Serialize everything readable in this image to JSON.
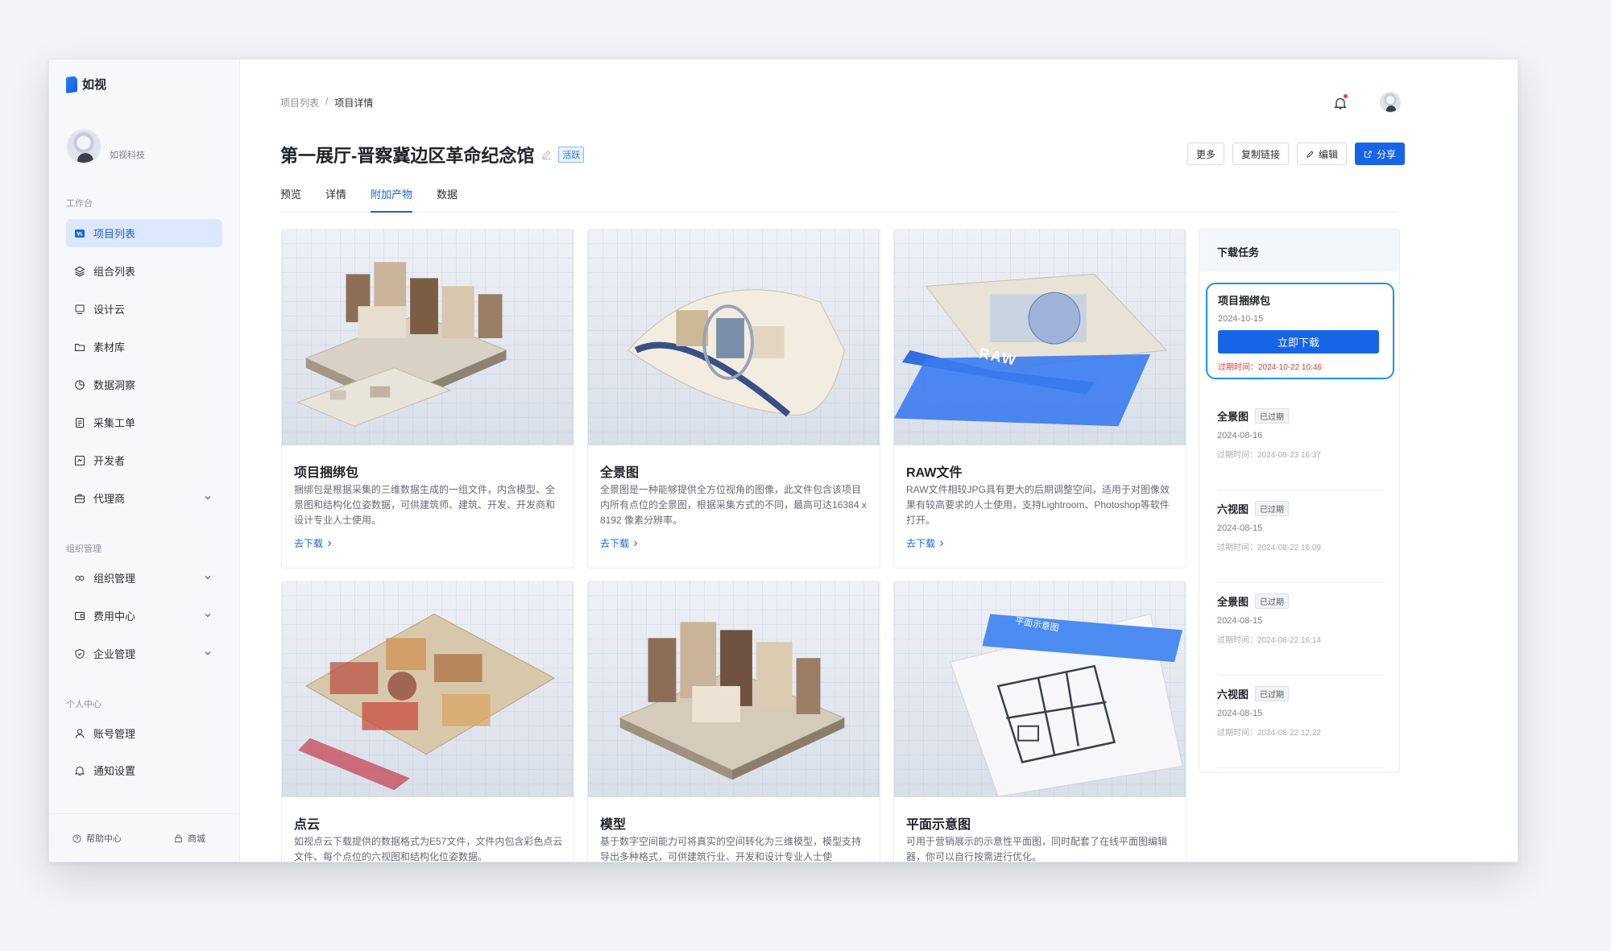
{
  "app": {
    "name": "如视"
  },
  "profile": {
    "org": "如视科技"
  },
  "sidebar": {
    "groups": [
      {
        "title": "工作台"
      },
      {
        "title": "组织管理"
      },
      {
        "title": "个人中心"
      }
    ],
    "items": [
      {
        "label": "项目列表",
        "icon": "project-list-icon"
      },
      {
        "label": "组合列表",
        "icon": "layers-icon"
      },
      {
        "label": "设计云",
        "icon": "monitor-icon"
      },
      {
        "label": "素材库",
        "icon": "folder-icon"
      },
      {
        "label": "数据洞察",
        "icon": "pie-chart-icon"
      },
      {
        "label": "采集工单",
        "icon": "document-icon"
      },
      {
        "label": "开发者",
        "icon": "code-icon"
      },
      {
        "label": "代理商",
        "icon": "briefcase-icon"
      },
      {
        "label": "组织管理",
        "icon": "org-icon"
      },
      {
        "label": "费用中心",
        "icon": "wallet-icon"
      },
      {
        "label": "企业管理",
        "icon": "shield-icon"
      },
      {
        "label": "账号管理",
        "icon": "user-icon"
      },
      {
        "label": "通知设置",
        "icon": "bell-icon"
      }
    ],
    "footer": {
      "help": "帮助中心",
      "store": "商城"
    }
  },
  "breadcrumb": {
    "parent": "项目列表",
    "separator": "/",
    "current": "项目详情"
  },
  "project": {
    "title": "第一展厅-晋察冀边区革命纪念馆",
    "status": "活跃"
  },
  "actions": {
    "more": "更多",
    "copy_link": "复制链接",
    "edit": "编辑",
    "share": "分享"
  },
  "tabs": [
    {
      "label": "预览"
    },
    {
      "label": "详情"
    },
    {
      "label": "附加产物"
    },
    {
      "label": "数据"
    }
  ],
  "products": [
    {
      "title": "项目捆绑包",
      "desc": "捆绑包是根据采集的三维数据生成的一组文件，内含模型、全景图和结构化位姿数据，可供建筑师、建筑、开发、开发商和设计专业人士使用。",
      "link": "去下载"
    },
    {
      "title": "全景图",
      "desc": "全景图是一种能够提供全方位视角的图像，此文件包含该项目内所有点位的全景图，根据采集方式的不同，最高可达16384 x 8192 像素分辨率。",
      "link": "去下载"
    },
    {
      "title": "RAW文件",
      "desc": "RAW文件相较JPG具有更大的后期调整空间，适用于对图像效果有较高要求的人士使用，支持Lightroom、Photoshop等软件打开。",
      "link": "去下载",
      "badge": "RAW"
    },
    {
      "title": "点云",
      "desc": "如视点云下载提供的数据格式为E57文件，文件内包含彩色点云文件、每个点位的六视图和结构化位姿数据。"
    },
    {
      "title": "模型",
      "desc": "基于数字空间能力可将真实的空间转化为三维模型，模型支持导出多种格式，可供建筑行业、开发和设计专业人士使"
    },
    {
      "title": "平面示意图",
      "desc": "可用于营销展示的示意性平面图，同时配套了在线平面图编辑器，你可以自行按需进行优化。",
      "badge": "平面示意图"
    }
  ],
  "downloads": {
    "title": "下载任务",
    "active": {
      "name": "项目捆绑包",
      "date": "2024-10-15",
      "button": "立即下载",
      "expiry": "过期时间：2024-10-22 10:46"
    },
    "items": [
      {
        "name": "全景图",
        "tag": "已过期",
        "date": "2024-08-16",
        "expiry": "过期时间：2024-08-23 16:37"
      },
      {
        "name": "六视图",
        "tag": "已过期",
        "date": "2024-08-15",
        "expiry": "过期时间：2024-08-22 16:09"
      },
      {
        "name": "全景图",
        "tag": "已过期",
        "date": "2024-08-15",
        "expiry": "过期时间：2024-08-22 16:14"
      },
      {
        "name": "六视图",
        "tag": "已过期",
        "date": "2024-08-15",
        "expiry": "过期时间：2024-08-22 12:22"
      }
    ]
  },
  "colors": {
    "accent": "#1764e8",
    "active_nav_bg": "#dce8ff",
    "expired_red": "#e03b3b"
  }
}
